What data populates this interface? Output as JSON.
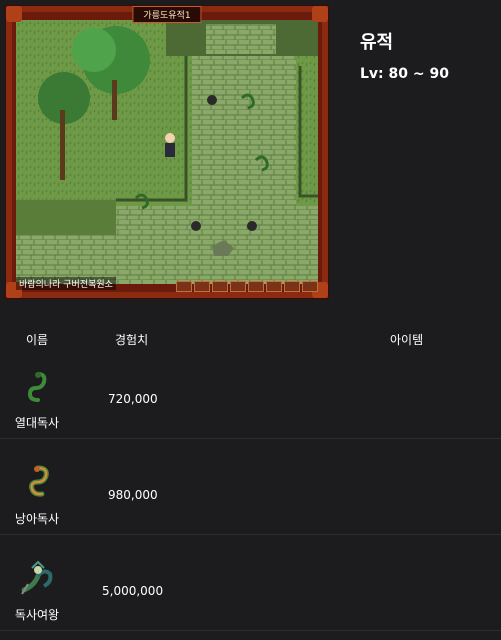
{
  "game": {
    "title": "가릉도유적1",
    "status": "바람의나라 구버전복원소"
  },
  "map": {
    "name": "유적",
    "level": "Lv: 80 ~ 90"
  },
  "table": {
    "headers": {
      "name": "이름",
      "exp": "경험치",
      "items": "아이템"
    },
    "rows": [
      {
        "name": "열대독사",
        "exp": "720,000",
        "icon": "green-snake-icon"
      },
      {
        "name": "낭아독사",
        "exp": "980,000",
        "icon": "orange-snake-icon"
      },
      {
        "name": "독사여왕",
        "exp": "5,000,000",
        "icon": "snake-queen-icon"
      }
    ]
  }
}
